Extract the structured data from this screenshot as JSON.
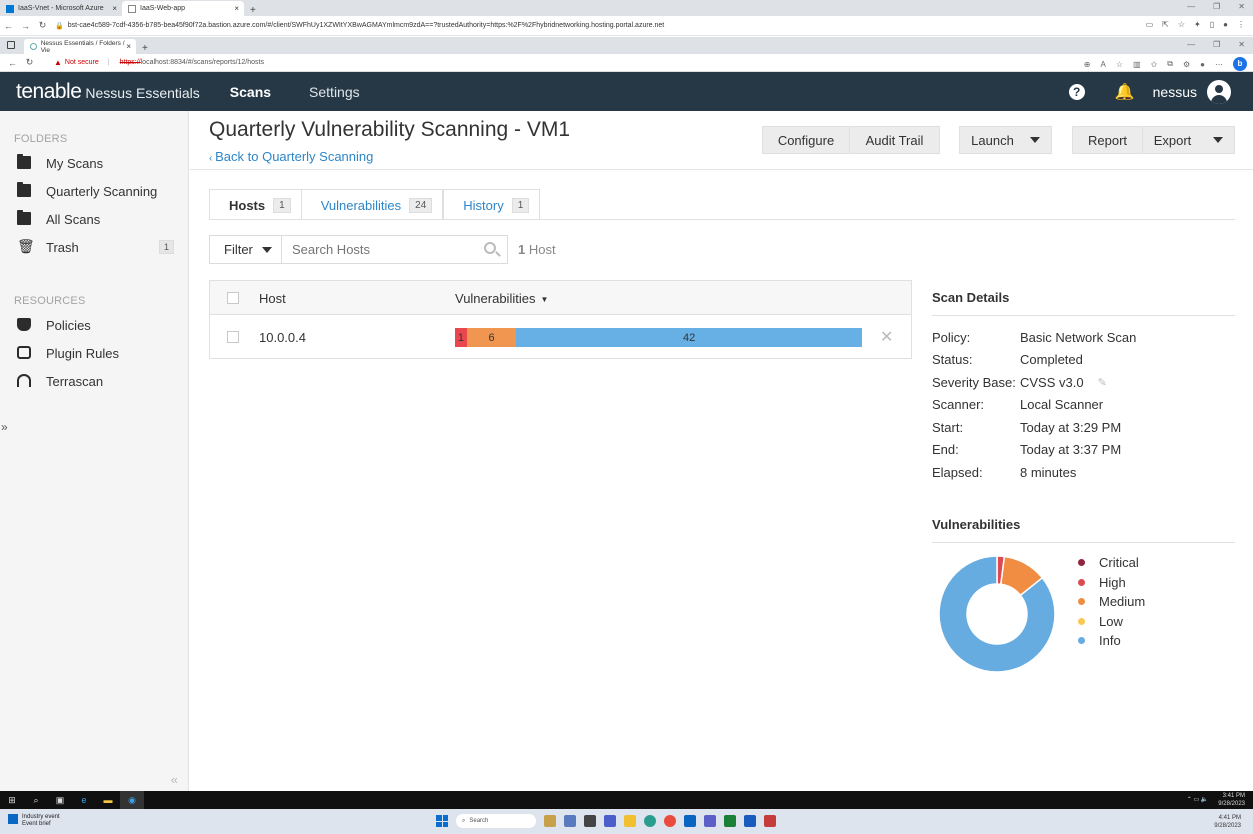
{
  "outer_browser": {
    "tabs": [
      {
        "label": "IaaS-Vnet - Microsoft Azure",
        "favicon_color": "#0078d4"
      },
      {
        "label": "IaaS-Web-app",
        "favicon_color": "#888888"
      }
    ],
    "url": "bst-cae4c589-7cdf-4356-b785-bea45f90f72a.bastion.azure.com/#/client/SWFhUy1XZWItYXBwAGMAYmlmcm9zdA==?trustedAuthority=https:%2F%2Fhybridnetworking.hosting.portal.azure.net"
  },
  "inner_browser": {
    "tab_label": "Nessus Essentials / Folders / Vie",
    "not_secure": "Not secure",
    "url_scheme": "https://",
    "url_rest": "localhost:8834/#/scans/reports/12/hosts"
  },
  "header": {
    "brand": "tenable",
    "product": "Nessus Essentials",
    "nav": [
      "Scans",
      "Settings"
    ],
    "help_label": "?",
    "username": "nessus"
  },
  "sidebar": {
    "folders_title": "FOLDERS",
    "folders": [
      {
        "label": "My Scans",
        "count": ""
      },
      {
        "label": "Quarterly Scanning",
        "count": ""
      },
      {
        "label": "All Scans",
        "count": ""
      },
      {
        "label": "Trash",
        "count": "1"
      }
    ],
    "resources_title": "RESOURCES",
    "resources": [
      {
        "label": "Policies"
      },
      {
        "label": "Plugin Rules"
      },
      {
        "label": "Terrascan"
      }
    ]
  },
  "page": {
    "title": "Quarterly Vulnerability Scanning - VM1",
    "back_link": "Back to Quarterly Scanning",
    "buttons": {
      "configure": "Configure",
      "audit_trail": "Audit Trail",
      "launch": "Launch",
      "report": "Report",
      "export": "Export"
    },
    "tabs": [
      {
        "label": "Hosts",
        "count": "1"
      },
      {
        "label": "Vulnerabilities",
        "count": "24"
      },
      {
        "label": "History",
        "count": "1"
      }
    ],
    "filter_label": "Filter",
    "search_placeholder": "Search Hosts",
    "host_count_num": "1",
    "host_count_label": "Host"
  },
  "hosts_table": {
    "columns": [
      "Host",
      "Vulnerabilities"
    ],
    "rows": [
      {
        "host": "10.0.0.4",
        "bar": [
          {
            "label": "1",
            "value": 1,
            "color": "#e9474d"
          },
          {
            "label": "6",
            "value": 6,
            "color": "#f09650"
          },
          {
            "label": "42",
            "value": 42,
            "color": "#67b0e5"
          }
        ]
      }
    ]
  },
  "scan_details": {
    "title": "Scan Details",
    "rows": [
      {
        "label": "Policy:",
        "value": "Basic Network Scan"
      },
      {
        "label": "Status:",
        "value": "Completed"
      },
      {
        "label": "Severity Base:",
        "value": "CVSS v3.0"
      },
      {
        "label": "Scanner:",
        "value": "Local Scanner"
      },
      {
        "label": "Start:",
        "value": "Today at 3:29 PM"
      },
      {
        "label": "End:",
        "value": "Today at 3:37 PM"
      },
      {
        "label": "Elapsed:",
        "value": "8 minutes"
      }
    ]
  },
  "vulnerabilities_panel": {
    "title": "Vulnerabilities",
    "legend": [
      {
        "label": "Critical",
        "color": "#91243e"
      },
      {
        "label": "High",
        "color": "#dd4b50"
      },
      {
        "label": "Medium",
        "color": "#f18c43"
      },
      {
        "label": "Low",
        "color": "#f8c851"
      },
      {
        "label": "Info",
        "color": "#67acE1"
      }
    ],
    "donut": [
      {
        "severity": "Critical",
        "value": 0,
        "color": "#91243e"
      },
      {
        "severity": "High",
        "value": 1,
        "color": "#dd4b50"
      },
      {
        "severity": "Medium",
        "value": 6,
        "color": "#f18c43"
      },
      {
        "severity": "Low",
        "value": 0,
        "color": "#f8c851"
      },
      {
        "severity": "Info",
        "value": 42,
        "color": "#67acE1"
      }
    ]
  },
  "taskbar": {
    "search_label": "Search",
    "event_title": "Industry event",
    "event_sub": "Event brief",
    "time": "4:41 PM",
    "date": "9/28/2023",
    "inner_time": "3:41 PM",
    "inner_date": "9/28/2023"
  }
}
